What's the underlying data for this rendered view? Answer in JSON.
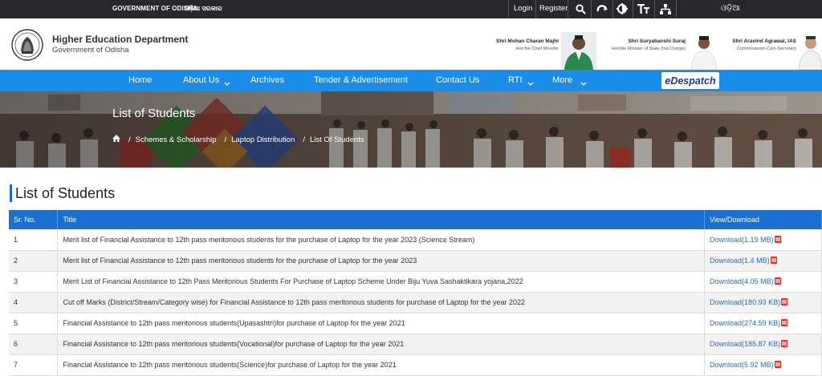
{
  "topbar": {
    "gov_label": "GOVERNMENT OF ODISHA",
    "gov_odia": "ଓଡ଼ିଶା ସରକାର",
    "login": "Login",
    "register": "Register",
    "language": "ଓଡ଼ିଆ",
    "icons": [
      "search-icon",
      "refresh-icon",
      "contrast-icon",
      "text-size-icon",
      "sitemap-icon"
    ]
  },
  "header": {
    "title": "Higher Education Department",
    "subtitle": "Government of Odisha",
    "people": [
      {
        "name": "Shri Mohan Charan Majhi",
        "role": "Hon'ble Chief Minister"
      },
      {
        "name": "Shri Suryabanshi Suraj",
        "role": "Hon'ble Minister of State (Ind.Charge)"
      },
      {
        "name": "Shri Aravind Agrawal, IAS",
        "role": "Commissioner-Cum-Secretary"
      }
    ]
  },
  "nav": {
    "items": [
      "Home",
      "About Us",
      "Archives",
      "Tender & Advertisement",
      "Contact Us",
      "RTI",
      "More"
    ],
    "despatch_label": "eDespatch"
  },
  "banner": {
    "title": "List of Students",
    "crumbs": [
      "Schemes & Scholarship",
      "Laptop Distribution",
      "List Of Students"
    ]
  },
  "page": {
    "heading": "List of Students"
  },
  "table": {
    "headers": [
      "Sr. No.",
      "Title",
      "View/Download"
    ],
    "rows": [
      {
        "sr": "1",
        "title": "Merit list of Financial Assistance to 12th pass meritorious students for the purchase of Laptop for the year 2023 (Science Stream)",
        "download": "Download(1.19 MB)"
      },
      {
        "sr": "2",
        "title": "Merit list of Financial Assistance to 12th pass meritorious students for the purchase of Laptop for the year 2023",
        "download": "Download(1.4 MB)"
      },
      {
        "sr": "3",
        "title": "Merit List of Financial Assistance to 12th Pass Meritorious Students For Purchase of Laptop Scheme Under Biju Yuva Sashaktikara yojana,2022",
        "download": "Download(4.05 MB)"
      },
      {
        "sr": "4",
        "title": "Cut off Marks (District/Stream/Category wise) for Financial Assistance to 12th pass meritorious students for purchase of Laptop for the year 2022",
        "download": "Download(180.93 KB)"
      },
      {
        "sr": "5",
        "title": "Financial Assistance to 12th pass meritorious students(Upasashtri)for purchase of Laptop for the year 2021",
        "download": "Download(274.59 KB)"
      },
      {
        "sr": "6",
        "title": "Financial Assistance to 12th pass meritorious students(Vocational)for purchase of Laptop for the year 2021",
        "download": "Download(185.87 KB)"
      },
      {
        "sr": "7",
        "title": "Financial Assistance to 12th pass meritorious students(Science)for purchase of Laptop for the year 2021",
        "download": "Download(5.92 MB)"
      }
    ]
  }
}
